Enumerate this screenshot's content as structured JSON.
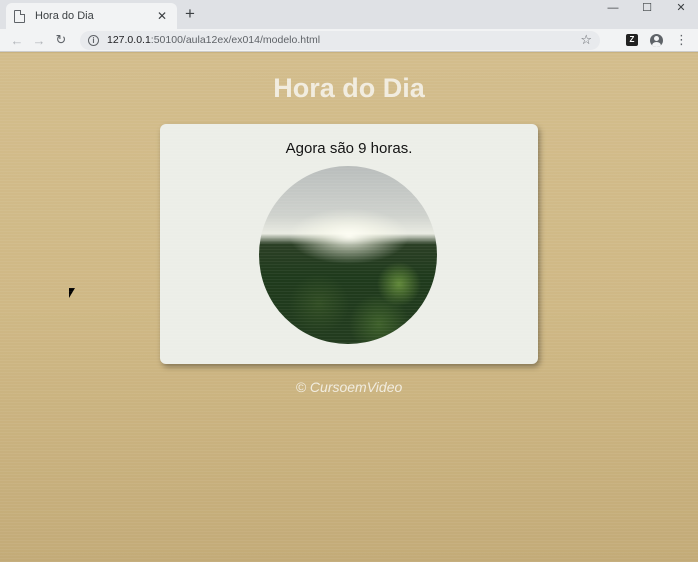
{
  "browser": {
    "tab": {
      "title": "Hora do Dia",
      "close": "✕"
    },
    "new_tab": "+",
    "window": {
      "minimize": "—",
      "maximize": "☐",
      "close": "✕"
    },
    "nav": {
      "back": "←",
      "forward": "→",
      "reload": "↻"
    },
    "address": {
      "host": "127.0.0.1",
      "rest": ":50100/aula12ex/ex014/modelo.html"
    }
  },
  "page": {
    "title": "Hora do Dia",
    "message": "Agora são 9 horas.",
    "credit": "© CursoemVideo"
  }
}
